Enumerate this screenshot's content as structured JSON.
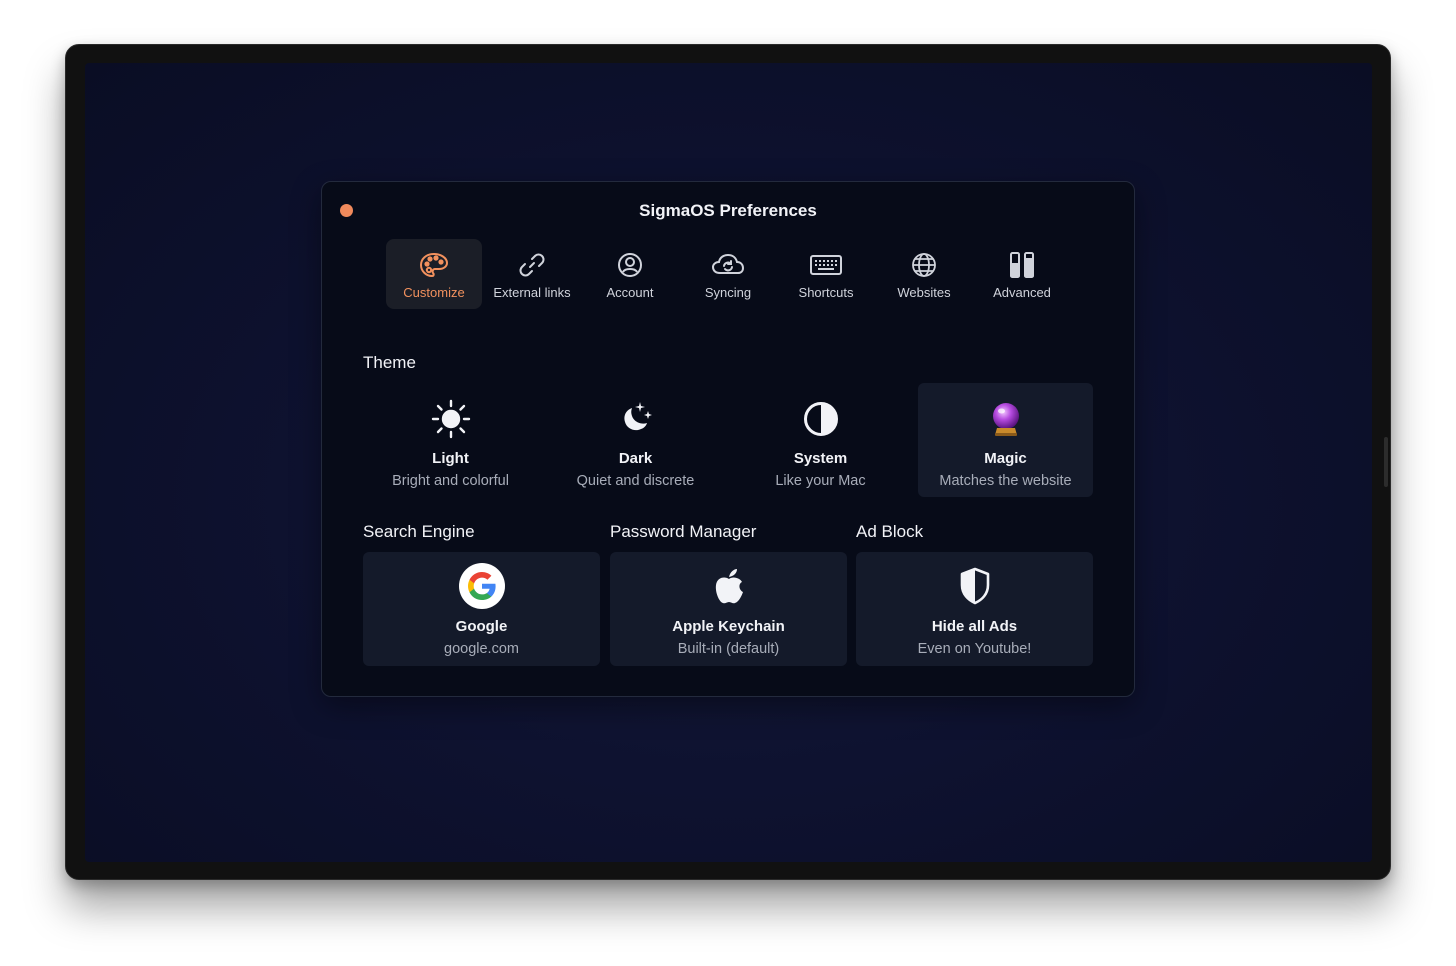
{
  "window": {
    "title": "SigmaOS Preferences"
  },
  "colors": {
    "accent": "#f2915e",
    "close": "#f08a5c",
    "card_bg": "#141a2a"
  },
  "tabs": [
    {
      "label": "Customize",
      "icon": "palette-icon",
      "active": true
    },
    {
      "label": "External links",
      "icon": "link-icon"
    },
    {
      "label": "Account",
      "icon": "account-icon"
    },
    {
      "label": "Syncing",
      "icon": "cloud-sync-icon"
    },
    {
      "label": "Shortcuts",
      "icon": "keyboard-icon"
    },
    {
      "label": "Websites",
      "icon": "globe-icon"
    },
    {
      "label": "Advanced",
      "icon": "test-tubes-icon"
    }
  ],
  "theme": {
    "heading": "Theme",
    "options": [
      {
        "name": "Light",
        "subtitle": "Bright and colorful",
        "icon": "sun-icon"
      },
      {
        "name": "Dark",
        "subtitle": "Quiet and discrete",
        "icon": "moon-stars-icon"
      },
      {
        "name": "System",
        "subtitle": "Like your Mac",
        "icon": "half-circle-icon"
      },
      {
        "name": "Magic",
        "subtitle": "Matches the website",
        "icon": "crystal-ball-icon",
        "selected": true
      }
    ]
  },
  "search_engine": {
    "heading": "Search Engine",
    "name": "Google",
    "subtitle": "google.com",
    "icon": "google-icon"
  },
  "password_manager": {
    "heading": "Password Manager",
    "name": "Apple Keychain",
    "subtitle": "Built-in (default)",
    "icon": "apple-icon"
  },
  "ad_block": {
    "heading": "Ad Block",
    "name": "Hide all Ads",
    "subtitle": "Even on Youtube!",
    "icon": "shield-icon"
  }
}
